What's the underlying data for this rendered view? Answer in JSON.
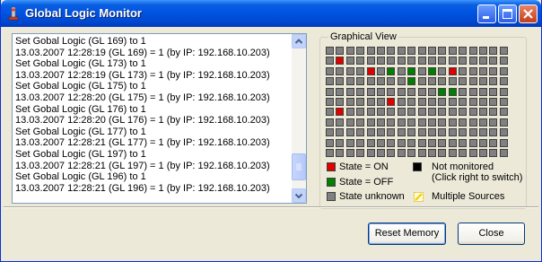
{
  "window": {
    "title": "Global Logic Monitor"
  },
  "log": {
    "lines": [
      "Set Gobal Logic  (GL 169) to 1",
      "13.03.2007 12:28:19  (GL 169) = 1 (by IP: 192.168.10.203)",
      "Set Gobal Logic  (GL 173) to 1",
      "13.03.2007 12:28:19  (GL 173) = 1 (by IP: 192.168.10.203)",
      "Set Gobal Logic  (GL 175) to 1",
      "13.03.2007 12:28:20  (GL 175) = 1 (by IP: 192.168.10.203)",
      "Set Gobal Logic  (GL 176) to 1",
      "13.03.2007 12:28:20  (GL 176) = 1 (by IP: 192.168.10.203)",
      "Set Gobal Logic  (GL 177) to 1",
      "13.03.2007 12:28:21  (GL 177) = 1 (by IP: 192.168.10.203)",
      "Set Gobal Logic  (GL 197) to 1",
      "13.03.2007 12:28:21  (GL 197) = 1 (by IP: 192.168.10.203)",
      "Set Gobal Logic  (GL 196) to 1",
      "13.03.2007 12:28:21  (GL 196) = 1 (by IP: 192.168.10.203)"
    ]
  },
  "graphical_view": {
    "title": "Graphical View",
    "colors": {
      "on": "#e00000",
      "off": "#007f00",
      "unknown": "#808080",
      "not_monitored": "#000000",
      "multiple": "#f5f500"
    },
    "rows": [
      "uuuuuuuuuuuuuuuuuu",
      "uouuuuuuuuuuuuuuuu",
      "uuuuoufufufuouuuuu",
      "uuuuuuuufuuuuuuuuu",
      "uuuuuuuuuuuffuuuuu",
      "uuuuuuouuuuuuuuuuu",
      "uouuuuuuuuuuuuuuuu",
      "uuuuuuuuuuuuuuuuuu",
      "uuuuuuuuuuuuuuuuuu",
      "uuuuuuuuuuuuuuuuuu",
      "uuuuuuuuuuuuuuuuuu"
    ],
    "legend": {
      "on": "State = ON",
      "off": "State = OFF",
      "unknown": "State unknown",
      "not_monitored_line1": "Not monitored",
      "not_monitored_line2": "(Click right to switch)",
      "multiple": "Multiple Sources"
    }
  },
  "buttons": {
    "reset": "Reset Memory",
    "close": "Close"
  }
}
